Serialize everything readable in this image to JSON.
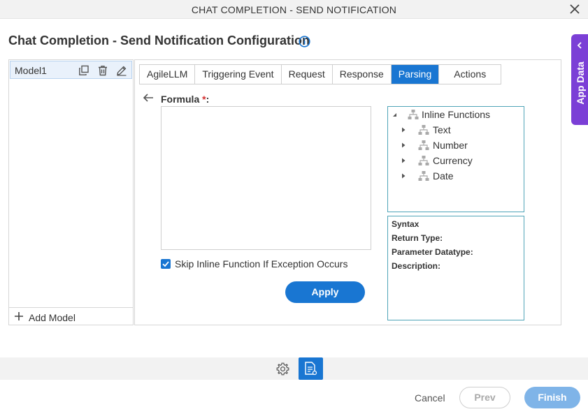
{
  "window": {
    "title": "CHAT COMPLETION - SEND NOTIFICATION"
  },
  "page": {
    "title": "Chat Completion - Send Notification Configuration"
  },
  "app_data": {
    "label": "App Data"
  },
  "models": {
    "items": [
      {
        "name": "Model1"
      }
    ],
    "add_label": "Add Model"
  },
  "tabs": [
    {
      "label": "AgileLLM",
      "active": false
    },
    {
      "label": "Triggering Event",
      "active": false
    },
    {
      "label": "Request",
      "active": false
    },
    {
      "label": "Response",
      "active": false
    },
    {
      "label": "Parsing",
      "active": true
    },
    {
      "label": "Actions",
      "active": false
    }
  ],
  "formula": {
    "label": "Formula",
    "required_marker": "*",
    "label_suffix": ":",
    "value": "",
    "skip_label": "Skip Inline Function If Exception Occurs",
    "skip_checked": true,
    "apply_label": "Apply"
  },
  "functions": {
    "root": "Inline Functions",
    "children": [
      {
        "label": "Text"
      },
      {
        "label": "Number"
      },
      {
        "label": "Currency"
      },
      {
        "label": "Date"
      }
    ]
  },
  "syntax": {
    "heading": "Syntax",
    "return_type": "Return Type:",
    "parameter_datatype": "Parameter Datatype:",
    "description": "Description:"
  },
  "footer": {
    "cancel": "Cancel",
    "prev": "Prev",
    "finish": "Finish"
  },
  "colors": {
    "accent": "#1976d2",
    "app_data": "#7b3fd6",
    "finish_disabled": "#7fb4e8",
    "tree_border": "#4fa4b8"
  }
}
